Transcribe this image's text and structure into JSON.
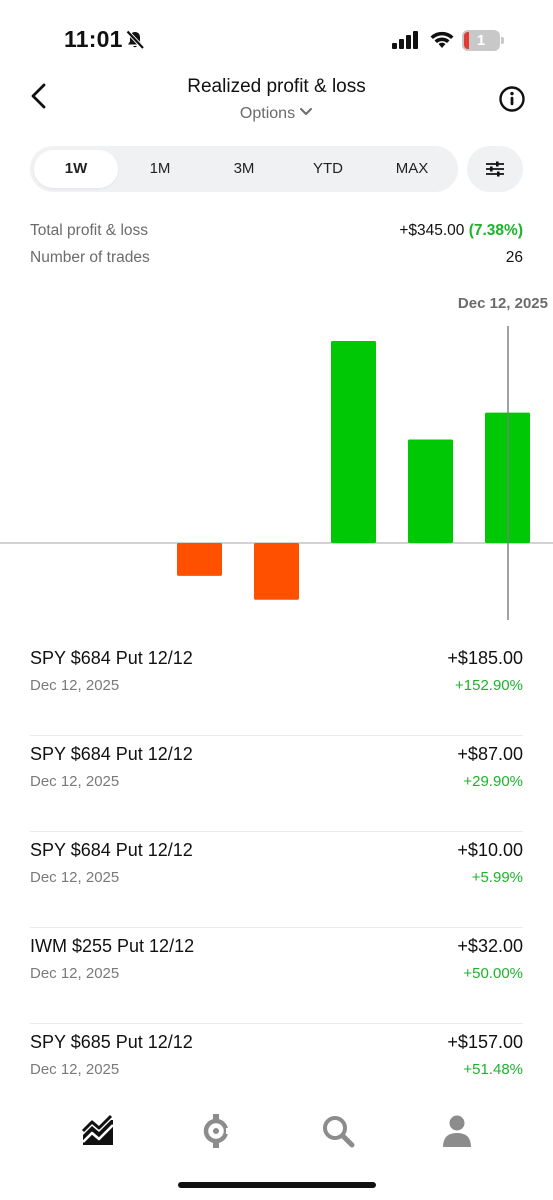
{
  "status": {
    "time": "11:01",
    "battery": "1"
  },
  "nav": {
    "title": "Realized profit & loss",
    "subtitle": "Options"
  },
  "ranges": [
    "1W",
    "1M",
    "3M",
    "YTD",
    "MAX"
  ],
  "active_range": "1W",
  "summary": {
    "total_label": "Total profit & loss",
    "total_value": "+$345.00",
    "total_pct": "(7.38%)",
    "trades_label": "Number of trades",
    "trades_value": "26"
  },
  "chart_data": {
    "type": "bar",
    "highlight_label": "Dec 12, 2025",
    "values": [
      0,
      0,
      -33,
      -57,
      203,
      104,
      131
    ],
    "colors": {
      "positive": "#00c805",
      "negative": "#ff5000",
      "baseline": "#b9b9b9",
      "cursor": "#7a7a7a"
    }
  },
  "trades": [
    {
      "name": "SPY $684 Put 12/12",
      "date": "Dec 12, 2025",
      "amount": "+$185.00",
      "pct": "+152.90%"
    },
    {
      "name": "SPY $684 Put 12/12",
      "date": "Dec 12, 2025",
      "amount": "+$87.00",
      "pct": "+29.90%"
    },
    {
      "name": "SPY $684 Put 12/12",
      "date": "Dec 12, 2025",
      "amount": "+$10.00",
      "pct": "+5.99%"
    },
    {
      "name": "IWM $255 Put 12/12",
      "date": "Dec 12, 2025",
      "amount": "+$32.00",
      "pct": "+50.00%"
    },
    {
      "name": "SPY $685 Put 12/12",
      "date": "Dec 12, 2025",
      "amount": "+$157.00",
      "pct": "+51.48%"
    }
  ],
  "tabbar": [
    "chart-icon",
    "options-icon",
    "search-icon",
    "profile-icon"
  ]
}
